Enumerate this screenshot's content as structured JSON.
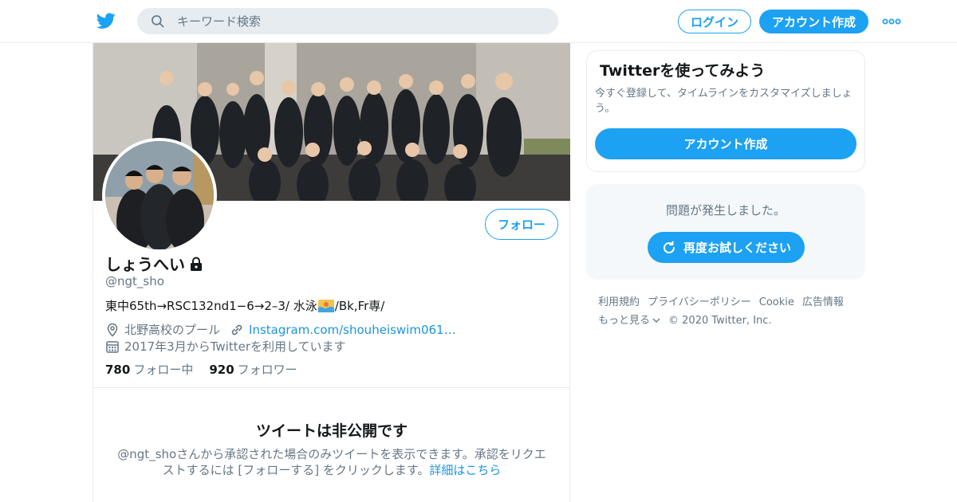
{
  "header": {
    "search_placeholder": "キーワード検索",
    "login_label": "ログイン",
    "signup_label": "アカウント作成"
  },
  "profile": {
    "display_name": "しょうへい",
    "handle": "@ngt_sho",
    "bio_part1": "東中65th→RSC132nd1−6→2–3/ 水泳",
    "bio_part2": "/Bk,Fr専/",
    "location": "北野高校のプール",
    "website": "Instagram.com/shouheiswim061…",
    "joined": "2017年3月からTwitterを利用しています",
    "follow_label": "フォロー",
    "following_count": "780",
    "following_label": "フォロー中",
    "followers_count": "920",
    "followers_label": "フォロワー"
  },
  "protected": {
    "title": "ツイートは非公開です",
    "message": "@ngt_shoさんから承認された場合のみツイートを表示できます。承認をリクエストするには [フォローする] をクリックします。",
    "link_label": "詳細はこちら"
  },
  "signup_card": {
    "title": "Twitterを使ってみよう",
    "text": "今すぐ登録して、タイムラインをカスタマイズしましょう。",
    "button_label": "アカウント作成"
  },
  "error_card": {
    "text": "問題が発生しました。",
    "retry_label": "再度お試しください"
  },
  "footer": {
    "terms": "利用規約",
    "privacy": "プライバシーポリシー",
    "cookie": "Cookie",
    "ads": "広告情報",
    "more": "もっと見る",
    "copyright": "© 2020 Twitter, Inc."
  },
  "colors": {
    "accent": "#1da1f2",
    "link": "#1b95e0",
    "secondary_text": "#657786",
    "border": "#e6ecf0"
  },
  "icons": [
    "twitter-bird-icon",
    "search-icon",
    "more-dots-icon",
    "lock-icon",
    "swim-emoji-icon",
    "location-pin-icon",
    "link-icon",
    "calendar-icon",
    "refresh-icon",
    "chevron-down-icon"
  ]
}
